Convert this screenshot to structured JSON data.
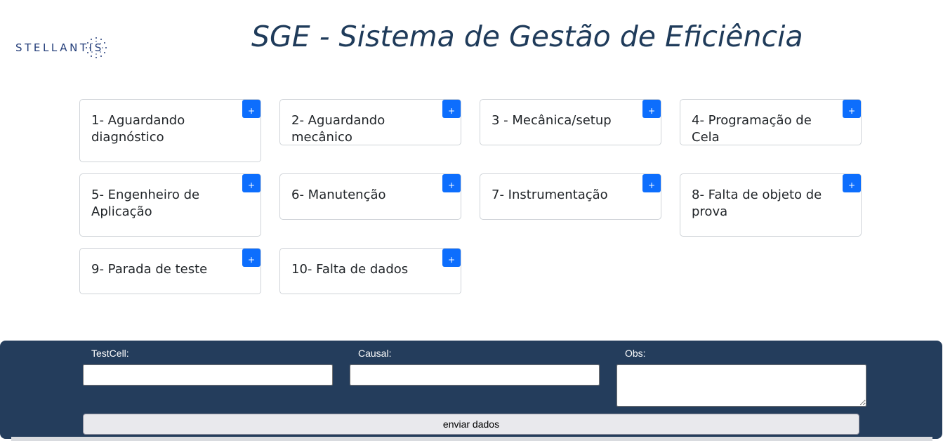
{
  "header": {
    "logo_text": "STELLANTIS",
    "title": "SGE - Sistema de Gestão de Eficiência"
  },
  "cards": [
    {
      "label": "1- Aguardando diagnóstico",
      "add_label": "+"
    },
    {
      "label": "2- Aguardando mecânico",
      "add_label": "+"
    },
    {
      "label": "3 - Mecânica/setup",
      "add_label": "+"
    },
    {
      "label": "4- Programação de Cela",
      "add_label": "+"
    },
    {
      "label": "5- Engenheiro de Aplicação",
      "add_label": "+"
    },
    {
      "label": "6- Manutenção",
      "add_label": "+"
    },
    {
      "label": "7- Instrumentação",
      "add_label": "+"
    },
    {
      "label": "8- Falta de objeto de prova",
      "add_label": "+"
    },
    {
      "label": "9- Parada de teste",
      "add_label": "+"
    },
    {
      "label": "10- Falta de dados",
      "add_label": "+"
    }
  ],
  "form": {
    "testcell_label": "TestCell:",
    "testcell_value": "",
    "causal_label": "Causal:",
    "causal_value": "",
    "obs_label": "Obs:",
    "obs_value": "",
    "submit_label": "enviar dados"
  },
  "colors": {
    "accent": "#0d6efd",
    "footer_bg": "#243d5c",
    "title": "#1f3b5a",
    "logo": "#243e7a"
  }
}
